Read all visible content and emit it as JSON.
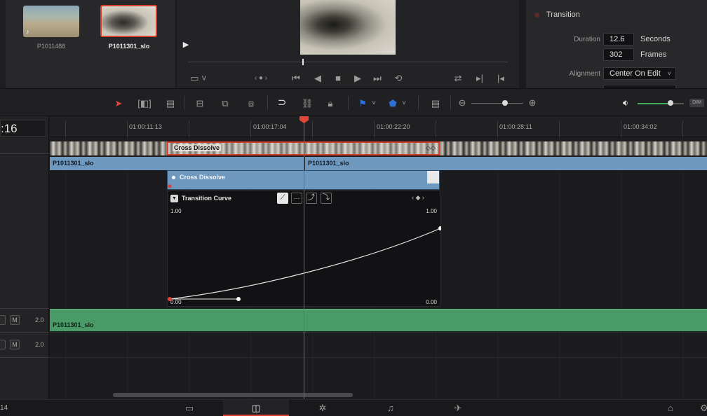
{
  "media_pool": {
    "clips": [
      {
        "name": "P1011488",
        "selected": false
      },
      {
        "name": "P1011301_slo",
        "selected": true
      }
    ]
  },
  "inspector": {
    "section_title": "Transition",
    "duration_label": "Duration",
    "duration_value": "12.6",
    "duration_unit": "Seconds",
    "frames_value": "302",
    "frames_unit": "Frames",
    "alignment_label": "Alignment",
    "alignment_value": "Center On Edit"
  },
  "timeline": {
    "timecode_fragment": ":16",
    "ruler_ticks": [
      "01:00:11:13",
      "01:00:17:04",
      "01:00:22:20",
      "01:00:28:11",
      "01:00:34:02"
    ],
    "video_transition_label": "Cross Dissolve",
    "audio_clip_1": "P1011301_slo",
    "audio_clip_2": "P1011301_slo",
    "audio_transition_label": "Cross Dissolve",
    "curve_panel_title": "Transition Curve",
    "curve_top_left": "1.00",
    "curve_top_right": "1.00",
    "curve_bottom_left": "0.00",
    "curve_bottom_right": "0.00",
    "audio_track_clip": "P1011301_slo",
    "track_level_1": "2.0",
    "track_level_2": "2.0",
    "mute_label": "M",
    "footer_number": "14"
  },
  "colors": {
    "accent_red": "#e2463a",
    "clip_blue": "#6f98be",
    "audio_green": "#4a9a67",
    "flag_blue": "#2f6fd8"
  },
  "icons": [
    "select-arrow-icon",
    "trim-icon",
    "blade-icon",
    "insert-icon",
    "overwrite-icon",
    "replace-icon",
    "snap-icon",
    "link-icon",
    "lock-icon",
    "flag-icon",
    "marker-icon",
    "zoom-out-icon",
    "zoom-in-icon",
    "volume-icon",
    "play-icon",
    "stop-icon",
    "loop-icon",
    "home-icon"
  ]
}
